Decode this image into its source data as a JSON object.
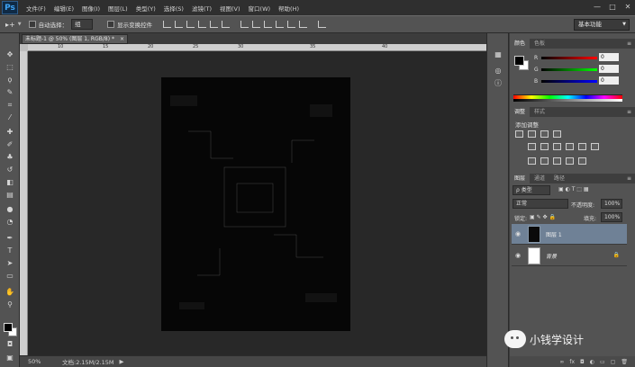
{
  "app": {
    "logo": "Ps"
  },
  "menu": [
    "文件(F)",
    "编辑(E)",
    "图像(I)",
    "图层(L)",
    "类型(Y)",
    "选择(S)",
    "滤镜(T)",
    "视图(V)",
    "窗口(W)",
    "帮助(H)"
  ],
  "window_controls": {
    "minimize": "—",
    "restore": "□",
    "close": "✕"
  },
  "options_bar": {
    "auto_select_label": "自动选择：",
    "auto_select_value": "组",
    "show_transform_label": "显示变换控件",
    "workspace": "基本功能"
  },
  "document": {
    "tab_title": "未标题-1 @ 50% (图层 1, RGB/8) *",
    "tab_close": "×",
    "ruler_ticks": [
      "10",
      "15",
      "20",
      "25",
      "30",
      "35",
      "40"
    ],
    "zoom": "50%",
    "doc_size": "文档:2.15M/2.15M",
    "status_arrow": "▶"
  },
  "color_panel": {
    "tabs": [
      "颜色",
      "色板"
    ],
    "channels": [
      {
        "label": "R",
        "value": "0"
      },
      {
        "label": "G",
        "value": "0"
      },
      {
        "label": "B",
        "value": "0"
      }
    ],
    "foreground": "#000000",
    "background": "#ffffff"
  },
  "adjustments_panel": {
    "tabs": [
      "调整",
      "样式"
    ],
    "title": "添加调整"
  },
  "layers_panel": {
    "tabs": [
      "图层",
      "通道",
      "路径"
    ],
    "filter_kind": "ρ 类型",
    "blend_mode": "正常",
    "opacity_label": "不透明度:",
    "opacity_value": "100%",
    "lock_label": "锁定:",
    "fill_label": "填充:",
    "fill_value": "100%",
    "layers": [
      {
        "name": "图层 1",
        "selected": true,
        "thumb": "#0a0a0a",
        "locked": false
      },
      {
        "name": "背景",
        "selected": false,
        "thumb": "#ffffff",
        "locked": true
      }
    ],
    "bottom_icons": [
      "∞",
      "fx",
      "◘",
      "◐",
      "▭",
      "▢",
      "🗑"
    ]
  },
  "watermark": {
    "text": "小钱学设计"
  },
  "accent": "#6f8196"
}
